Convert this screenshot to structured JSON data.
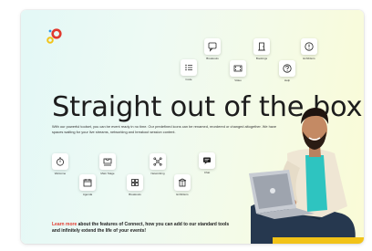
{
  "brand": {
    "colors": {
      "red": "#e03a2f",
      "yellow": "#f2c318",
      "blue": "#2b9be8",
      "teal": "#2ec4c0"
    }
  },
  "hero": {
    "headline": "Straight out of the box",
    "description": "With our powerful toolset, you can be event ready in no time. Our predefined icons can be renamed, reordered or changed altogether. We have spaces waiting for your live streams, networking and breakout session content.",
    "cta": {
      "link_text": "Learn more",
      "rest": " about the features of Connect, how you can add to our standard tools and infinitely extend the life of your events!"
    }
  },
  "top_icons": [
    {
      "label": "Breakouts",
      "icon": "chat-bubble-icon"
    },
    {
      "label": "Bookings",
      "icon": "door-icon"
    },
    {
      "label": "Exhibitors",
      "icon": "exclamation-icon"
    },
    {
      "label": "Code",
      "icon": "list-icon"
    },
    {
      "label": "Video",
      "icon": "film-icon"
    },
    {
      "label": "Help",
      "icon": "question-icon"
    }
  ],
  "bottom_icons": [
    {
      "label": "Welcome",
      "icon": "stopwatch-icon"
    },
    {
      "label": "Agenda",
      "icon": "calendar-icon"
    },
    {
      "label": "Main Stage",
      "icon": "stage-icon"
    },
    {
      "label": "Breakouts",
      "icon": "grid-icon"
    },
    {
      "label": "Networking",
      "icon": "network-icon"
    },
    {
      "label": "Exhibitors",
      "icon": "booth-icon"
    },
    {
      "label": "Chat",
      "icon": "chat-icon"
    }
  ]
}
